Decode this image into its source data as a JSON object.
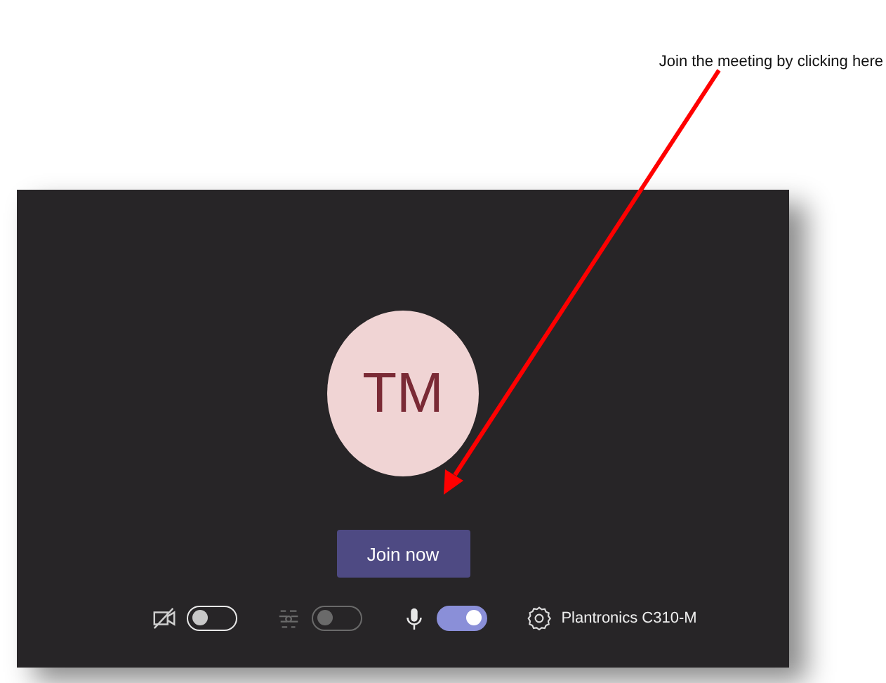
{
  "annotation": {
    "text": "Join the meeting by clicking here"
  },
  "avatar": {
    "initials": "TM"
  },
  "join_button": {
    "label": "Join now"
  },
  "controls": [
    {
      "kind": "camera",
      "on": false,
      "disabled": false
    },
    {
      "kind": "blur",
      "on": false,
      "disabled": true
    },
    {
      "kind": "mic",
      "on": true,
      "disabled": false
    }
  ],
  "device": {
    "name": "Plantronics C310-M"
  }
}
